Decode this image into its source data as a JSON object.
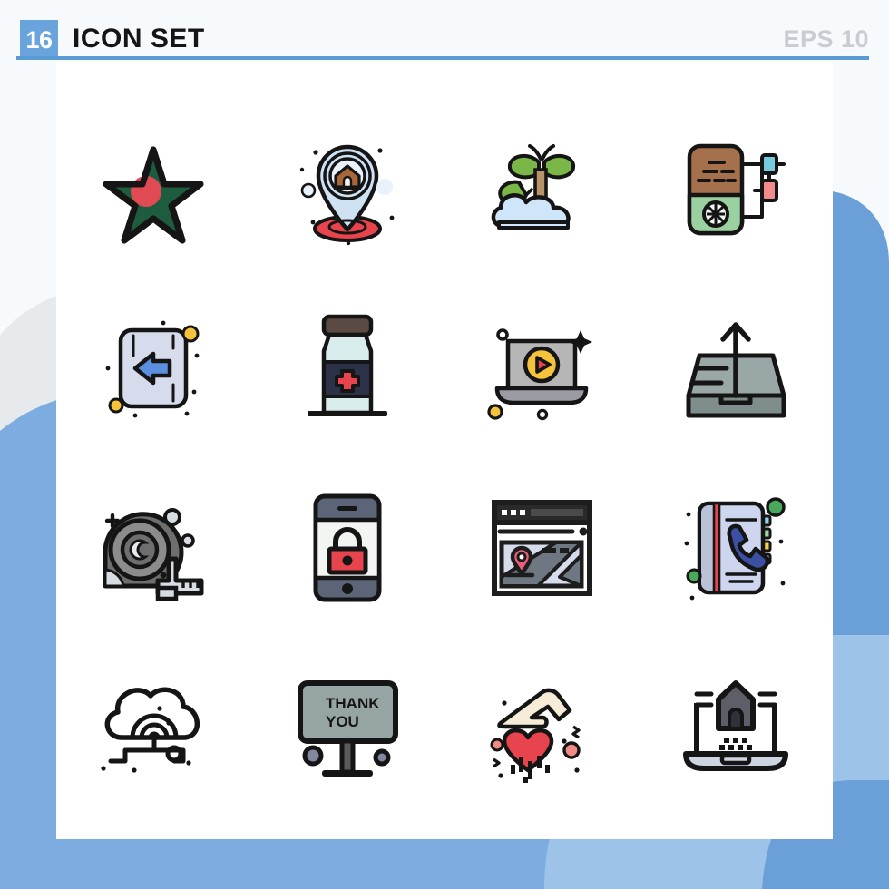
{
  "header": {
    "count_badge": "16",
    "title": "ICON SET",
    "format": "EPS 10",
    "badge_color": "#6aa4dc",
    "rule_color": "#5b9bd5",
    "title_color": "#151515",
    "format_color": "#c9cdd2"
  },
  "background": {
    "page_color": "#f7fafd",
    "canvas_color": "#ffffff",
    "blob_light": "#9dc3e9",
    "blob_mid": "#7dade0",
    "blob_dark": "#6a9fd8",
    "blob_gray": "#e6eaed"
  },
  "grid": {
    "columns": 4,
    "rows": 4,
    "total": 16
  },
  "icons": [
    {
      "index": 1,
      "row": 1,
      "col": 1,
      "name": "star-icon",
      "label": "Star",
      "colors": [
        "#1d5c3f",
        "#e04a52",
        "#151515"
      ]
    },
    {
      "index": 2,
      "row": 1,
      "col": 2,
      "name": "location-home-pin-icon",
      "label": "Home Location Pin",
      "colors": [
        "#cfe2f3",
        "#a7673b",
        "#e8444d",
        "#151515"
      ]
    },
    {
      "index": 3,
      "row": 1,
      "col": 3,
      "name": "sprout-cloud-icon",
      "label": "Sprout",
      "colors": [
        "#7ab648",
        "#cfe6fa",
        "#a98055",
        "#151515"
      ]
    },
    {
      "index": 4,
      "row": 1,
      "col": 4,
      "name": "device-module-icon",
      "label": "Device Module",
      "colors": [
        "#a4714c",
        "#9bd1a0",
        "#76ccdd",
        "#f28b8b",
        "#151515"
      ]
    },
    {
      "index": 5,
      "row": 2,
      "col": 1,
      "name": "back-arrow-icon",
      "label": "Back Arrow",
      "colors": [
        "#d6dcec",
        "#5b8fe0",
        "#f5c33b",
        "#151515"
      ]
    },
    {
      "index": 6,
      "row": 2,
      "col": 2,
      "name": "medicine-bottle-icon",
      "label": "Medicine Bottle",
      "colors": [
        "#d9ecec",
        "#2b3247",
        "#e8444d",
        "#5a4a43",
        "#151515"
      ]
    },
    {
      "index": 7,
      "row": 2,
      "col": 3,
      "name": "video-laptop-icon",
      "label": "Video Laptop",
      "colors": [
        "#b6b6b6",
        "#f5c33b",
        "#e8444d",
        "#151515"
      ]
    },
    {
      "index": 8,
      "row": 2,
      "col": 4,
      "name": "outbox-tray-icon",
      "label": "Outbox Tray",
      "colors": [
        "#9aa7a7",
        "#7f8d8d",
        "#151515"
      ]
    },
    {
      "index": 9,
      "row": 3,
      "col": 1,
      "name": "measuring-tape-icon",
      "label": "Measuring Tape",
      "colors": [
        "#6e6e6e",
        "#8c8c8c",
        "#d8dde3",
        "#151515"
      ]
    },
    {
      "index": 10,
      "row": 3,
      "col": 2,
      "name": "mobile-lock-icon",
      "label": "Mobile Lock",
      "colors": [
        "#5b6577",
        "#f2f5f2",
        "#e8444d",
        "#151515"
      ]
    },
    {
      "index": 11,
      "row": 3,
      "col": 3,
      "name": "browser-map-icon",
      "label": "Browser Map",
      "colors": [
        "#1d1d1d",
        "#d6dcec",
        "#e8607a",
        "#6e7782",
        "#151515"
      ]
    },
    {
      "index": 12,
      "row": 3,
      "col": 4,
      "name": "phone-book-icon",
      "label": "Phone Book",
      "colors": [
        "#cdd6ee",
        "#3b4fa3",
        "#e8444d",
        "#4aa85a",
        "#151515"
      ]
    },
    {
      "index": 13,
      "row": 4,
      "col": 1,
      "name": "cloud-network-icon",
      "label": "Cloud Network",
      "colors": [
        "#151515"
      ]
    },
    {
      "index": 14,
      "row": 4,
      "col": 2,
      "name": "thank-you-sign-icon",
      "label": "Thank You Sign",
      "colors": [
        "#96a5a3",
        "#5a5a5a",
        "#8287a0",
        "#151515"
      ]
    },
    {
      "index": 15,
      "row": 4,
      "col": 3,
      "name": "hand-heart-icon",
      "label": "Hand Heart",
      "colors": [
        "#f6ecd7",
        "#e8444d",
        "#f08c84",
        "#151515"
      ]
    },
    {
      "index": 16,
      "row": 4,
      "col": 4,
      "name": "laptop-home-icon",
      "label": "Laptop Home",
      "colors": [
        "#5c5f68",
        "#cdd4e2",
        "#151515"
      ]
    }
  ],
  "sign_text": {
    "line1": "THANK",
    "line2": "YOU"
  }
}
